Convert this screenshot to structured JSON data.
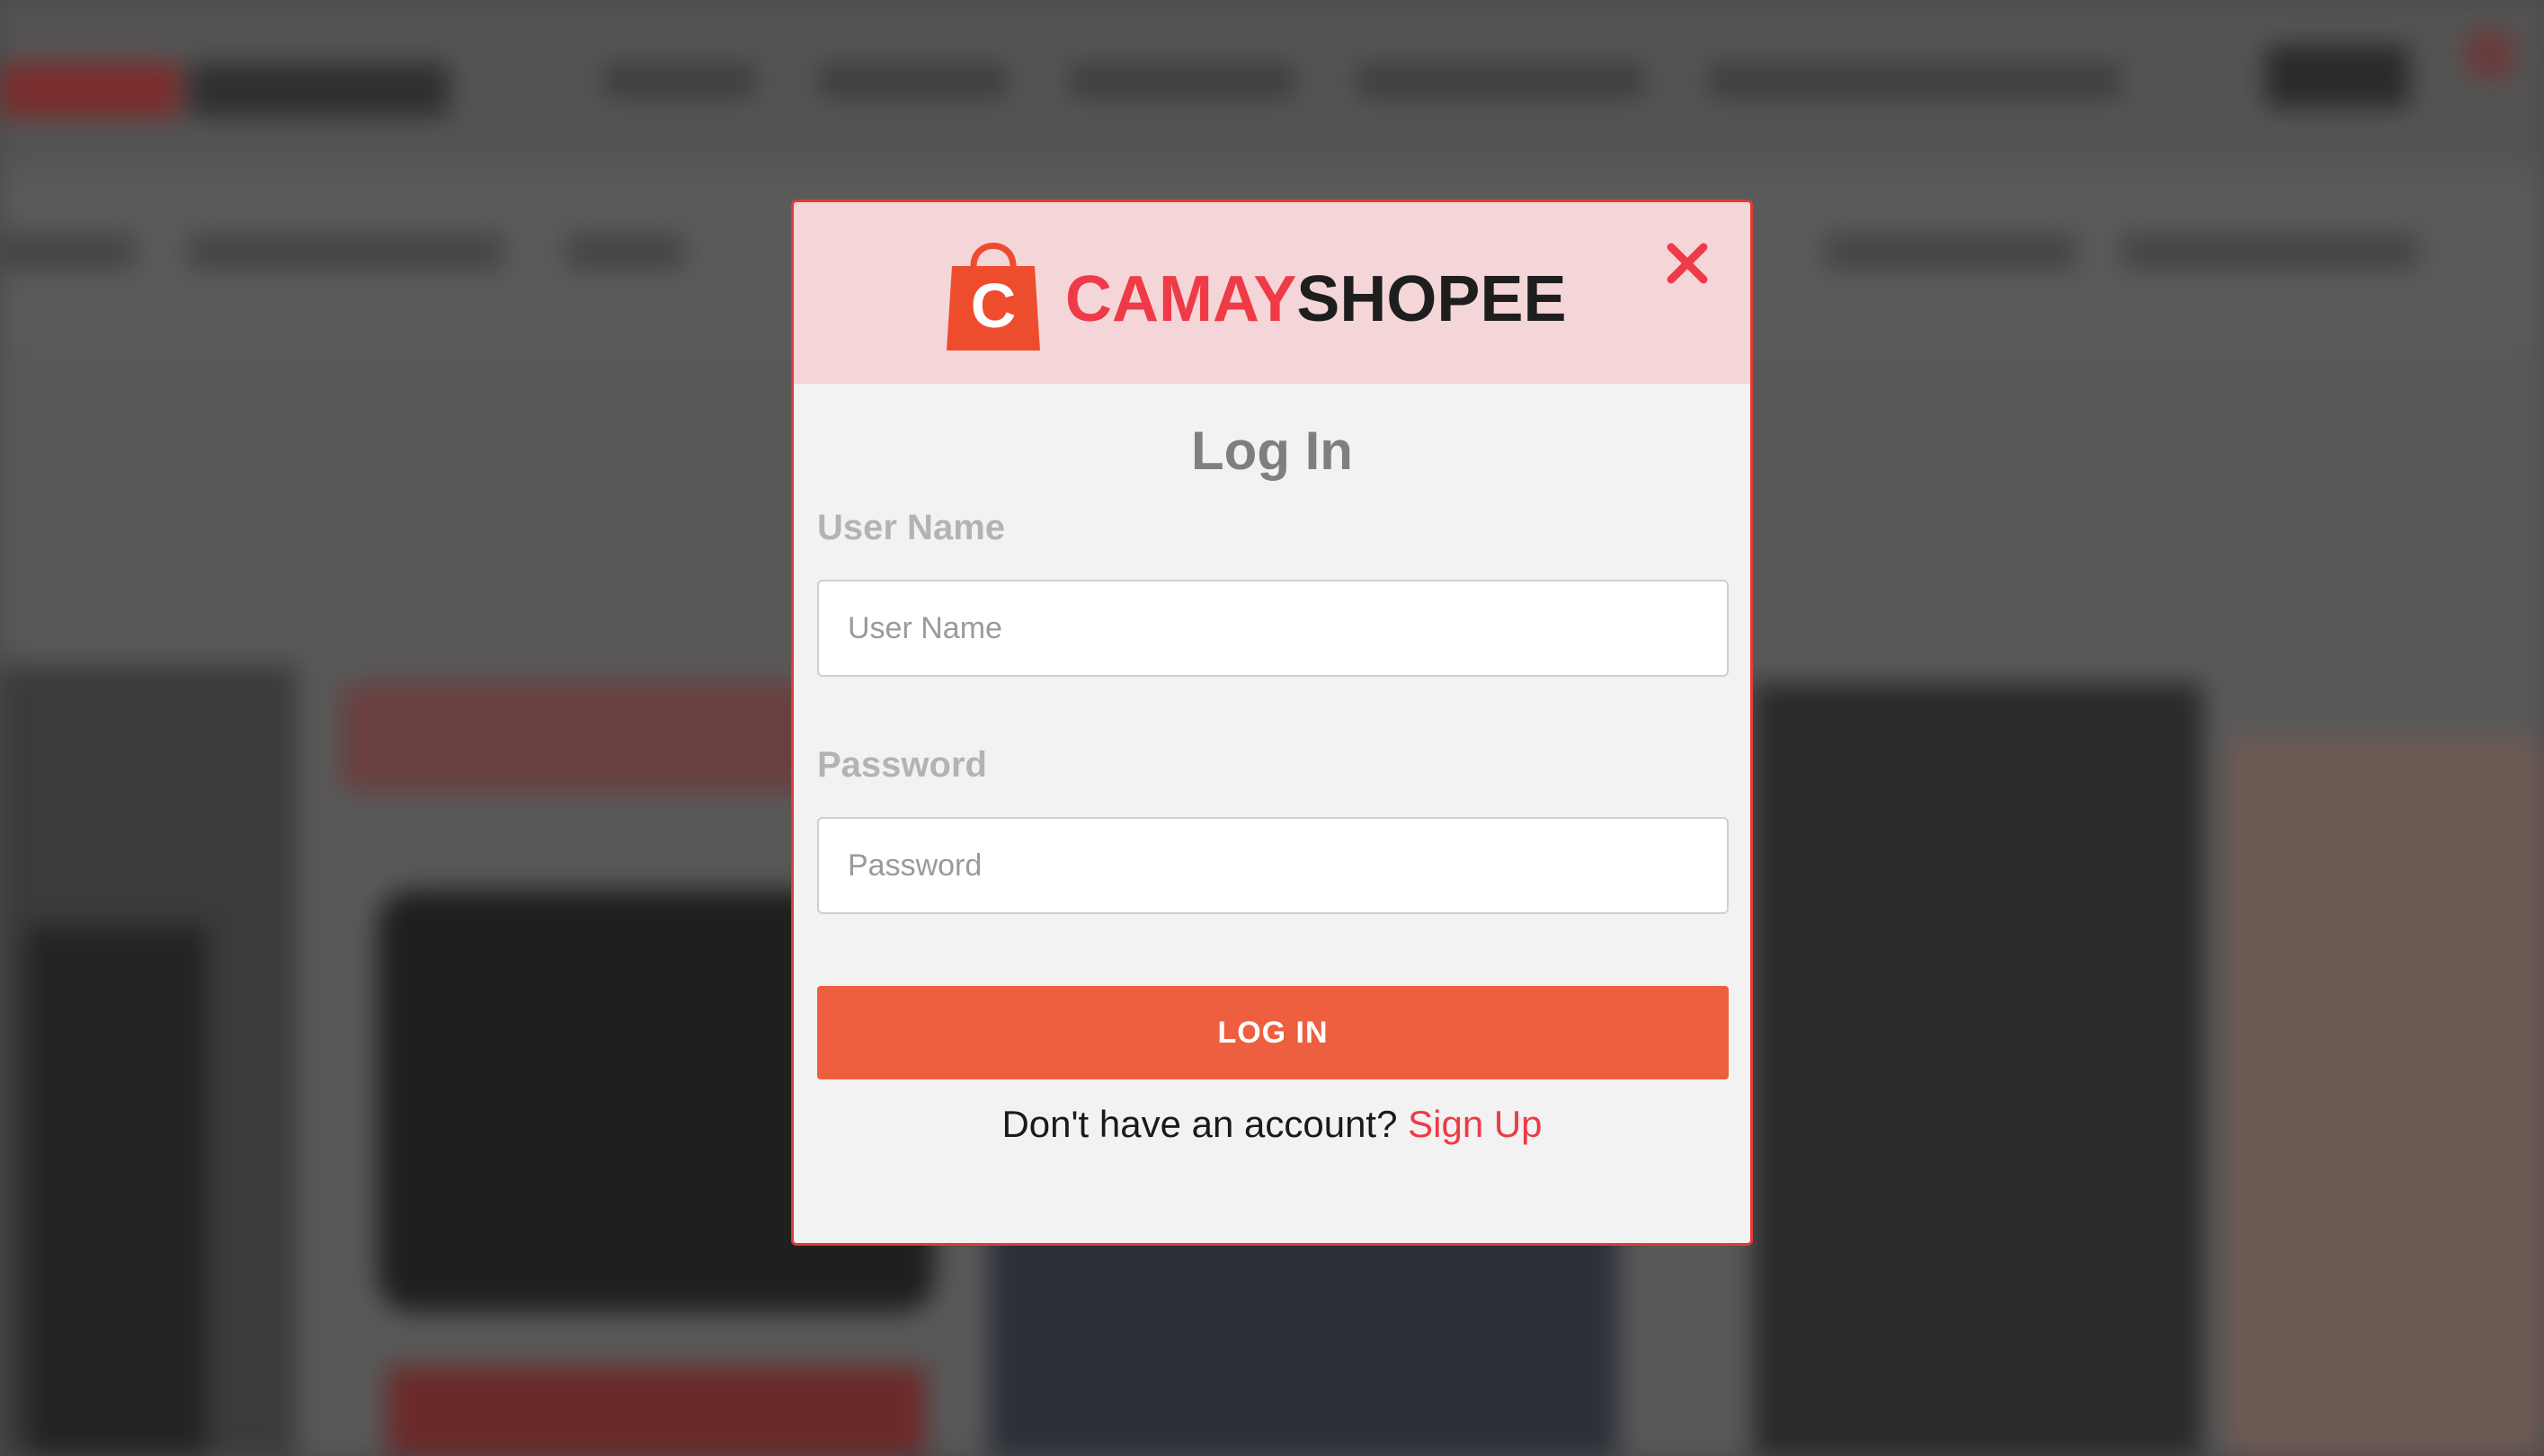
{
  "brand": {
    "name_part1": "CAMAY",
    "name_part2": "SHOPEE",
    "bag_letter": "C",
    "colors": {
      "accent": "#ee3b47",
      "dark": "#1e1e1e",
      "bag": "#ee4d2d"
    }
  },
  "modal": {
    "title": "Log In",
    "close_icon": "close-icon",
    "username": {
      "label": "User Name",
      "placeholder": "User Name",
      "value": ""
    },
    "password": {
      "label": "Password",
      "placeholder": "Password",
      "value": ""
    },
    "login_button": "LOG IN",
    "signup_prompt": "Don't have an account?",
    "signup_link": "Sign Up",
    "colors": {
      "header_bg": "#f5d6d8",
      "button_bg": "#ee5f3f",
      "border": "#e53935",
      "link": "#ee3b47"
    }
  }
}
